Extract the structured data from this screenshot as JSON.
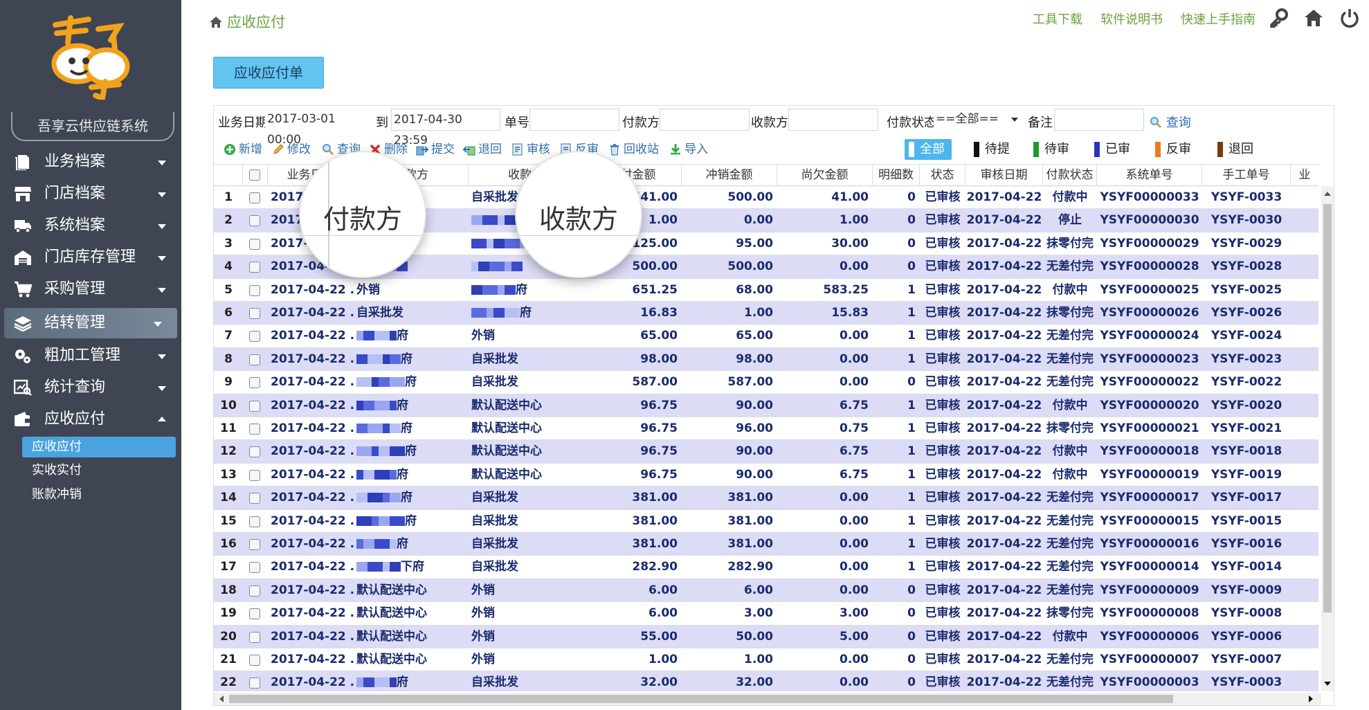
{
  "colors": {
    "sidebar_bg": "#3f4552",
    "accent_blue": "#4eb5ee",
    "green_text": "#6aa33d",
    "row_alt": "#dcdcf6",
    "data_text": "#1a2b6e"
  },
  "sidebar": {
    "brand": "吾享云供应链系统",
    "menu": [
      {
        "label": "业务档案",
        "icon": "file-icon",
        "expanded": false,
        "active": false
      },
      {
        "label": "门店档案",
        "icon": "store-icon",
        "expanded": false,
        "active": false
      },
      {
        "label": "系统档案",
        "icon": "truck-icon",
        "expanded": false,
        "active": false
      },
      {
        "label": "门店库存管理",
        "icon": "warehouse-icon",
        "expanded": false,
        "active": false
      },
      {
        "label": "采购管理",
        "icon": "cart-icon",
        "expanded": false,
        "active": false
      },
      {
        "label": "结转管理",
        "icon": "layers-icon",
        "expanded": false,
        "active": true
      },
      {
        "label": "粗加工管理",
        "icon": "gears-icon",
        "expanded": false,
        "active": false
      },
      {
        "label": "统计查询",
        "icon": "chart-search-icon",
        "expanded": false,
        "active": false
      },
      {
        "label": "应收应付",
        "icon": "wallet-icon",
        "expanded": true,
        "active": false
      }
    ],
    "submenu": [
      "应收应付",
      "实收实付",
      "账款冲销"
    ]
  },
  "header": {
    "breadcrumb": "应收应付",
    "links": [
      "工具下载",
      "软件说明书",
      "快速上手指南"
    ],
    "icons": [
      "key-icon",
      "home-icon",
      "power-icon"
    ]
  },
  "bill_button": "应收应付单",
  "filter": {
    "date_label": "业务日期",
    "date_from": "2017-03-01 00:00",
    "to_label": "到",
    "date_to": "2017-04-30 23:59",
    "bill_no_label": "单号",
    "bill_no": "",
    "payer_label": "付款方",
    "payer": "",
    "payee_label": "收款方",
    "payee": "",
    "pay_status_label": "付款状态",
    "pay_status": "==全部==",
    "remark_label": "备注",
    "remark": "",
    "query_label": "查询"
  },
  "toolbar": {
    "actions": [
      {
        "label": "新增",
        "icon": "plus-icon"
      },
      {
        "label": "修改",
        "icon": "pencil-icon"
      },
      {
        "label": "查询",
        "icon": "search-icon"
      },
      {
        "label": "删除",
        "icon": "delete-icon"
      },
      {
        "label": "提交",
        "icon": "submit-icon"
      },
      {
        "label": "退回",
        "icon": "return-icon"
      },
      {
        "label": "审核",
        "icon": "audit-icon"
      },
      {
        "label": "反审",
        "icon": "unaudit-icon"
      },
      {
        "label": "回收站",
        "icon": "recycle-icon"
      },
      {
        "label": "导入",
        "icon": "import-icon"
      }
    ],
    "status_filters": [
      {
        "label": "全部",
        "color": "#ffffff",
        "active": true
      },
      {
        "label": "待提",
        "color": "#111111",
        "active": false
      },
      {
        "label": "待审",
        "color": "#1f9a2e",
        "active": false
      },
      {
        "label": "已审",
        "color": "#2a33b8",
        "active": false
      },
      {
        "label": "反审",
        "color": "#f07a22",
        "active": false
      },
      {
        "label": "退回",
        "color": "#7a3a12",
        "active": false
      }
    ]
  },
  "table": {
    "columns": [
      "",
      "",
      "业务日期",
      "付款方",
      "收款方",
      "应付金额",
      "冲销金额",
      "尚欠金额",
      "明细数",
      "状态",
      "审核日期",
      "付款状态",
      "系统单号",
      "手工单号",
      "业"
    ],
    "rows": [
      {
        "n": "1",
        "date": "2017-04-22 ...",
        "payer": "",
        "payee": "自采批发",
        "amount": "541.00",
        "writeoff": "500.00",
        "owed": "41.00",
        "detail": "0",
        "status": "已审核",
        "audit_date": "2017-04-22",
        "pay_status": "付款中",
        "sys_no": "YSYF00000033",
        "manual_no": "YSYF-0033"
      },
      {
        "n": "2",
        "date": "2017-04-22 ...",
        "payer": "",
        "payee": "",
        "amount": "1.00",
        "writeoff": "0.00",
        "owed": "1.00",
        "detail": "0",
        "status": "已审核",
        "audit_date": "2017-04-22",
        "pay_status": "停止",
        "sys_no": "YSYF00000030",
        "manual_no": "YSYF-0030"
      },
      {
        "n": "3",
        "date": "2017-04-22 ...",
        "payer": "",
        "payee": "",
        "amount": "125.00",
        "writeoff": "95.00",
        "owed": "30.00",
        "detail": "0",
        "status": "已审核",
        "audit_date": "2017-04-22",
        "pay_status": "抹零付完",
        "sys_no": "YSYF00000029",
        "manual_no": "YSYF-0029"
      },
      {
        "n": "4",
        "date": "2017-04-22 ...",
        "payer": "",
        "payee": "",
        "amount": "500.00",
        "writeoff": "500.00",
        "owed": "0.00",
        "detail": "0",
        "status": "已审核",
        "audit_date": "2017-04-22",
        "pay_status": "无差付完",
        "sys_no": "YSYF00000028",
        "manual_no": "YSYF-0028"
      },
      {
        "n": "5",
        "date": "2017-04-22 ...",
        "payer": "外销",
        "payee": "府",
        "amount": "651.25",
        "writeoff": "68.00",
        "owed": "583.25",
        "detail": "1",
        "status": "已审核",
        "audit_date": "2017-04-22",
        "pay_status": "付款中",
        "sys_no": "YSYF00000025",
        "manual_no": "YSYF-0025"
      },
      {
        "n": "6",
        "date": "2017-04-22 ...",
        "payer": "自采批发",
        "payee": "府",
        "amount": "16.83",
        "writeoff": "1.00",
        "owed": "15.83",
        "detail": "1",
        "status": "已审核",
        "audit_date": "2017-04-22",
        "pay_status": "抹零付完",
        "sys_no": "YSYF00000026",
        "manual_no": "YSYF-0026"
      },
      {
        "n": "7",
        "date": "2017-04-22 ...",
        "payer": "府",
        "payee": "外销",
        "amount": "65.00",
        "writeoff": "65.00",
        "owed": "0.00",
        "detail": "1",
        "status": "已审核",
        "audit_date": "2017-04-22",
        "pay_status": "无差付完",
        "sys_no": "YSYF00000024",
        "manual_no": "YSYF-0024"
      },
      {
        "n": "8",
        "date": "2017-04-22 ...",
        "payer": "府",
        "payee": "自采批发",
        "amount": "98.00",
        "writeoff": "98.00",
        "owed": "0.00",
        "detail": "1",
        "status": "已审核",
        "audit_date": "2017-04-22",
        "pay_status": "无差付完",
        "sys_no": "YSYF00000023",
        "manual_no": "YSYF-0023"
      },
      {
        "n": "9",
        "date": "2017-04-22 ...",
        "payer": "府",
        "payee": "自采批发",
        "amount": "587.00",
        "writeoff": "587.00",
        "owed": "0.00",
        "detail": "0",
        "status": "已审核",
        "audit_date": "2017-04-22",
        "pay_status": "无差付完",
        "sys_no": "YSYF00000022",
        "manual_no": "YSYF-0022"
      },
      {
        "n": "10",
        "date": "2017-04-22 ...",
        "payer": "府",
        "payee": "默认配送中心",
        "amount": "96.75",
        "writeoff": "90.00",
        "owed": "6.75",
        "detail": "1",
        "status": "已审核",
        "audit_date": "2017-04-22",
        "pay_status": "付款中",
        "sys_no": "YSYF00000020",
        "manual_no": "YSYF-0020"
      },
      {
        "n": "11",
        "date": "2017-04-22 ...",
        "payer": "府",
        "payee": "默认配送中心",
        "amount": "96.75",
        "writeoff": "96.00",
        "owed": "0.75",
        "detail": "1",
        "status": "已审核",
        "audit_date": "2017-04-22",
        "pay_status": "抹零付完",
        "sys_no": "YSYF00000021",
        "manual_no": "YSYF-0021"
      },
      {
        "n": "12",
        "date": "2017-04-22 ...",
        "payer": "府",
        "payee": "默认配送中心",
        "amount": "96.75",
        "writeoff": "90.00",
        "owed": "6.75",
        "detail": "1",
        "status": "已审核",
        "audit_date": "2017-04-22",
        "pay_status": "付款中",
        "sys_no": "YSYF00000018",
        "manual_no": "YSYF-0018"
      },
      {
        "n": "13",
        "date": "2017-04-22 ...",
        "payer": "府",
        "payee": "默认配送中心",
        "amount": "96.75",
        "writeoff": "90.00",
        "owed": "6.75",
        "detail": "1",
        "status": "已审核",
        "audit_date": "2017-04-22",
        "pay_status": "付款中",
        "sys_no": "YSYF00000019",
        "manual_no": "YSYF-0019"
      },
      {
        "n": "14",
        "date": "2017-04-22 ...",
        "payer": "府",
        "payee": "自采批发",
        "amount": "381.00",
        "writeoff": "381.00",
        "owed": "0.00",
        "detail": "1",
        "status": "已审核",
        "audit_date": "2017-04-22",
        "pay_status": "无差付完",
        "sys_no": "YSYF00000017",
        "manual_no": "YSYF-0017"
      },
      {
        "n": "15",
        "date": "2017-04-22 ...",
        "payer": "府",
        "payee": "自采批发",
        "amount": "381.00",
        "writeoff": "381.00",
        "owed": "0.00",
        "detail": "1",
        "status": "已审核",
        "audit_date": "2017-04-22",
        "pay_status": "无差付完",
        "sys_no": "YSYF00000015",
        "manual_no": "YSYF-0015"
      },
      {
        "n": "16",
        "date": "2017-04-22 ...",
        "payer": "府",
        "payee": "自采批发",
        "amount": "381.00",
        "writeoff": "381.00",
        "owed": "0.00",
        "detail": "1",
        "status": "已审核",
        "audit_date": "2017-04-22",
        "pay_status": "无差付完",
        "sys_no": "YSYF00000016",
        "manual_no": "YSYF-0016"
      },
      {
        "n": "17",
        "date": "2017-04-22 ...",
        "payer": "下府",
        "payee": "自采批发",
        "amount": "282.90",
        "writeoff": "282.90",
        "owed": "0.00",
        "detail": "1",
        "status": "已审核",
        "audit_date": "2017-04-22",
        "pay_status": "无差付完",
        "sys_no": "YSYF00000014",
        "manual_no": "YSYF-0014"
      },
      {
        "n": "18",
        "date": "2017-04-22 ...",
        "payer": "默认配送中心",
        "payee": "外销",
        "amount": "6.00",
        "writeoff": "6.00",
        "owed": "0.00",
        "detail": "0",
        "status": "已审核",
        "audit_date": "2017-04-22",
        "pay_status": "无差付完",
        "sys_no": "YSYF00000009",
        "manual_no": "YSYF-0009"
      },
      {
        "n": "19",
        "date": "2017-04-22 ...",
        "payer": "默认配送中心",
        "payee": "外销",
        "amount": "6.00",
        "writeoff": "3.00",
        "owed": "3.00",
        "detail": "0",
        "status": "已审核",
        "audit_date": "2017-04-22",
        "pay_status": "抹零付完",
        "sys_no": "YSYF00000008",
        "manual_no": "YSYF-0008"
      },
      {
        "n": "20",
        "date": "2017-04-22 ...",
        "payer": "默认配送中心",
        "payee": "外销",
        "amount": "55.00",
        "writeoff": "50.00",
        "owed": "5.00",
        "detail": "0",
        "status": "已审核",
        "audit_date": "2017-04-22",
        "pay_status": "付款中",
        "sys_no": "YSYF00000006",
        "manual_no": "YSYF-0006"
      },
      {
        "n": "21",
        "date": "2017-04-22 ...",
        "payer": "默认配送中心",
        "payee": "外销",
        "amount": "1.00",
        "writeoff": "1.00",
        "owed": "0.00",
        "detail": "0",
        "status": "已审核",
        "audit_date": "2017-04-22",
        "pay_status": "无差付完",
        "sys_no": "YSYF00000007",
        "manual_no": "YSYF-0007"
      },
      {
        "n": "22",
        "date": "2017-04-22 ...",
        "payer": "府",
        "payee": "自采批发",
        "amount": "32.00",
        "writeoff": "32.00",
        "owed": "0.00",
        "detail": "0",
        "status": "已审核",
        "audit_date": "2017-04-22",
        "pay_status": "无差付完",
        "sys_no": "YSYF00000003",
        "manual_no": "YSYF-0003"
      }
    ]
  },
  "magnifiers": [
    "付款方",
    "收款方"
  ]
}
